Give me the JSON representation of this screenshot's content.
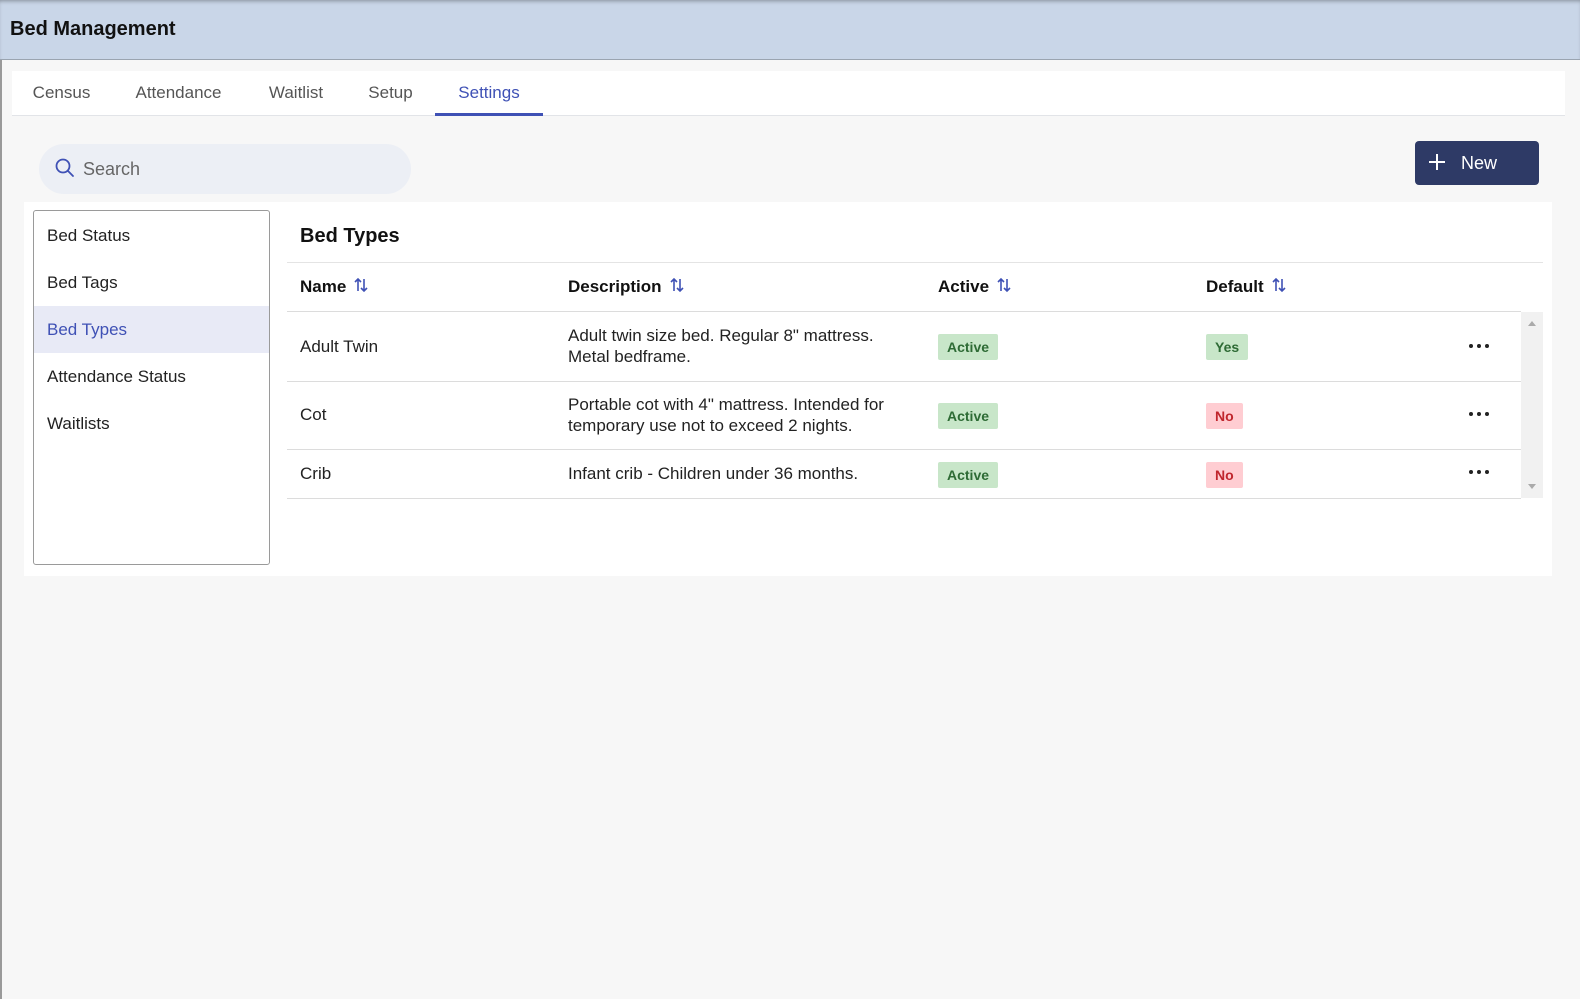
{
  "app": {
    "title": "Bed Management"
  },
  "tabs": [
    {
      "label": "Census"
    },
    {
      "label": "Attendance"
    },
    {
      "label": "Waitlist"
    },
    {
      "label": "Setup"
    },
    {
      "label": "Settings",
      "active": true
    }
  ],
  "search": {
    "placeholder": "Search",
    "value": "",
    "icon": "search-icon"
  },
  "new_button": {
    "label": "New",
    "icon": "plus-icon"
  },
  "side_nav": {
    "items": [
      {
        "label": "Bed Status"
      },
      {
        "label": "Bed Tags"
      },
      {
        "label": "Bed Types",
        "active": true
      },
      {
        "label": "Attendance Status"
      },
      {
        "label": "Waitlists"
      }
    ]
  },
  "content": {
    "title": "Bed Types",
    "columns": [
      {
        "label": "Name",
        "sortable": true
      },
      {
        "label": "Description",
        "sortable": true
      },
      {
        "label": "Active",
        "sortable": true
      },
      {
        "label": "Default",
        "sortable": true
      }
    ],
    "rows": [
      {
        "name": "Adult Twin",
        "description_lines": [
          "Adult twin size bed. Regular 8\" mattress.",
          "Metal bedframe."
        ],
        "active": "Active",
        "default": "Yes"
      },
      {
        "name": "Cot",
        "description_lines": [
          "Portable cot with 4\" mattress. Intended for",
          "temporary use not to exceed 2 nights."
        ],
        "active": "Active",
        "default": "No"
      },
      {
        "name": "Crib",
        "description_lines": [
          "Infant crib - Children under 36 months."
        ],
        "active": "Active",
        "default": "No"
      }
    ]
  },
  "colors": {
    "header_bg": "#c9d6e8",
    "accent": "#3f51b5",
    "primary_button": "#2e3a66",
    "badge_green_bg": "#c8e6c9",
    "badge_green_text": "#2e6b35",
    "badge_red_bg": "#ffcdd2",
    "badge_red_text": "#c0262d"
  }
}
